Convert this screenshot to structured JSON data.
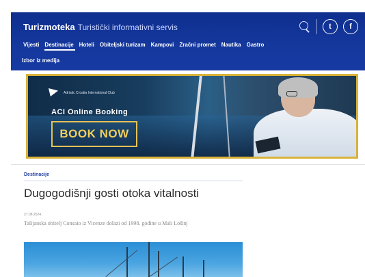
{
  "header": {
    "brand_bold": "Turizmoteka",
    "brand_tagline": "Turistički informativni servis",
    "social": [
      "twitter-icon",
      "facebook-icon"
    ],
    "social_glyphs": [
      "t",
      "f"
    ]
  },
  "nav": {
    "items": [
      {
        "label": "Vijesti",
        "active": false
      },
      {
        "label": "Destinacije",
        "active": true
      },
      {
        "label": "Hoteli",
        "active": false
      },
      {
        "label": "Obiteljski turizam",
        "active": false
      },
      {
        "label": "Kampovi",
        "active": false
      },
      {
        "label": "Zračni promet",
        "active": false
      },
      {
        "label": "Nautika",
        "active": false
      },
      {
        "label": "Gastro",
        "active": false
      }
    ],
    "second_row": "Izbor iz medija"
  },
  "ad": {
    "logo_text": "Adriatic Croatia International Club",
    "headline": "ACI Online Booking",
    "button_label": "BOOK NOW",
    "accent_color": "#d9b338"
  },
  "article": {
    "category": "Destinacije",
    "title": "Dugogodišnji gosti otoka vitalnosti",
    "date": "27.08.2024.",
    "excerpt": "Talijanska obitelj Consaio iz Vicenze dolazi od 1998. godine u Mali Lošinj"
  },
  "colors": {
    "header_bg": "#15389e",
    "link_blue": "#2440a0"
  }
}
